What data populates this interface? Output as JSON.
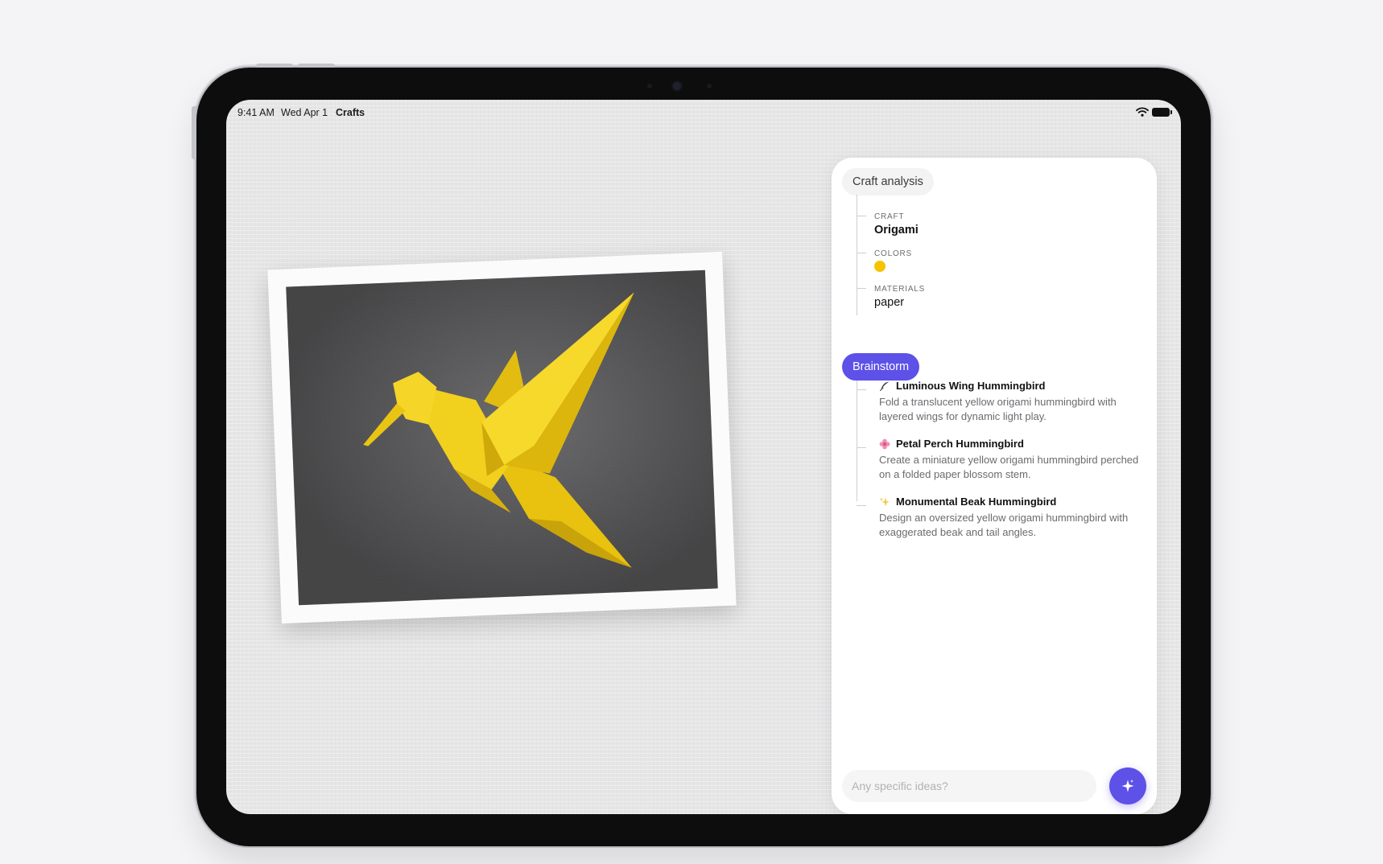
{
  "status_bar": {
    "time": "9:41 AM",
    "date": "Wed Apr 1",
    "app_name": "Crafts",
    "icons": [
      "wifi-icon",
      "battery-icon"
    ]
  },
  "photo": {
    "subject": "yellow origami hummingbird",
    "colors": {
      "paper": "#F2D01E",
      "background": "#5F5F61"
    }
  },
  "analysis": {
    "header": "Craft analysis",
    "craft_label": "CRAFT",
    "craft_value": "Origami",
    "colors_label": "COLORS",
    "color_swatches": [
      "#F5C400"
    ],
    "materials_label": "MATERIALS",
    "materials_value": "paper"
  },
  "brainstorm": {
    "button_label": "Brainstorm",
    "accent": "#5D51E8",
    "ideas": [
      {
        "icon": "feather-icon",
        "title": "Luminous Wing Hummingbird",
        "description": "Fold a translucent yellow origami hummingbird with layered wings for dynamic light play."
      },
      {
        "icon": "blossom-icon",
        "title": "Petal Perch Hummingbird",
        "description": "Create a miniature yellow origami hummingbird perched on a folded paper blossom stem."
      },
      {
        "icon": "sparkle-icon",
        "title": "Monumental Beak Hummingbird",
        "description": "Design an oversized yellow origami hummingbird with exaggerated beak and tail angles."
      }
    ]
  },
  "prompt": {
    "placeholder": "Any specific ideas?",
    "value": "",
    "submit_icon": "sparkle-icon"
  }
}
